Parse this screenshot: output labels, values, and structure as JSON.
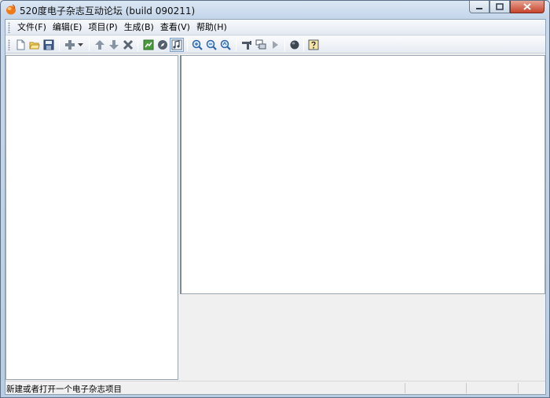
{
  "window": {
    "title": "520度电子杂志互动论坛 (build 090211)",
    "accent": "#f07a1a"
  },
  "menu": {
    "items": [
      {
        "label": "文件(F)",
        "name": "menu-file"
      },
      {
        "label": "编辑(E)",
        "name": "menu-edit"
      },
      {
        "label": "项目(P)",
        "name": "menu-project"
      },
      {
        "label": "生成(B)",
        "name": "menu-build"
      },
      {
        "label": "查看(V)",
        "name": "menu-view"
      },
      {
        "label": "帮助(H)",
        "name": "menu-help"
      }
    ]
  },
  "toolbar": {
    "icons": [
      "new-icon",
      "open-folder-icon",
      "save-icon",
      "add-page-icon",
      "dropdown-arrow-icon",
      "move-up-icon",
      "move-down-icon",
      "delete-icon",
      "preview-icon",
      "compass-icon",
      "music-icon",
      "zoom-in-icon",
      "zoom-out-icon",
      "zoom-fit-icon",
      "settings-tool-icon",
      "publish-icon",
      "play-icon",
      "globe-icon",
      "help-icon"
    ]
  },
  "status": {
    "text": "新建或者打开一个电子杂志项目"
  }
}
